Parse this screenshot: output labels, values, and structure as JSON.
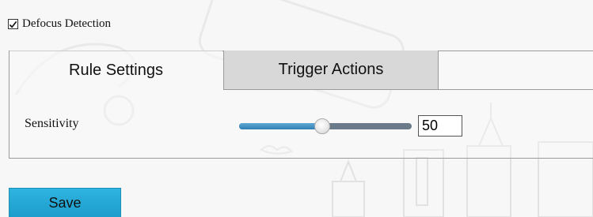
{
  "detection": {
    "label": "Defocus Detection",
    "checked": true
  },
  "tabs": [
    {
      "label": "Rule Settings",
      "active": true
    },
    {
      "label": "Trigger Actions",
      "active": false
    }
  ],
  "sensitivity": {
    "label": "Sensitivity",
    "value": "50",
    "level_percent": 48
  },
  "actions": {
    "save_label": "Save"
  },
  "colors": {
    "accent": "#1c9dcb",
    "slider_fill": "#3b8fc4",
    "slider_track": "#6b7b8a"
  }
}
